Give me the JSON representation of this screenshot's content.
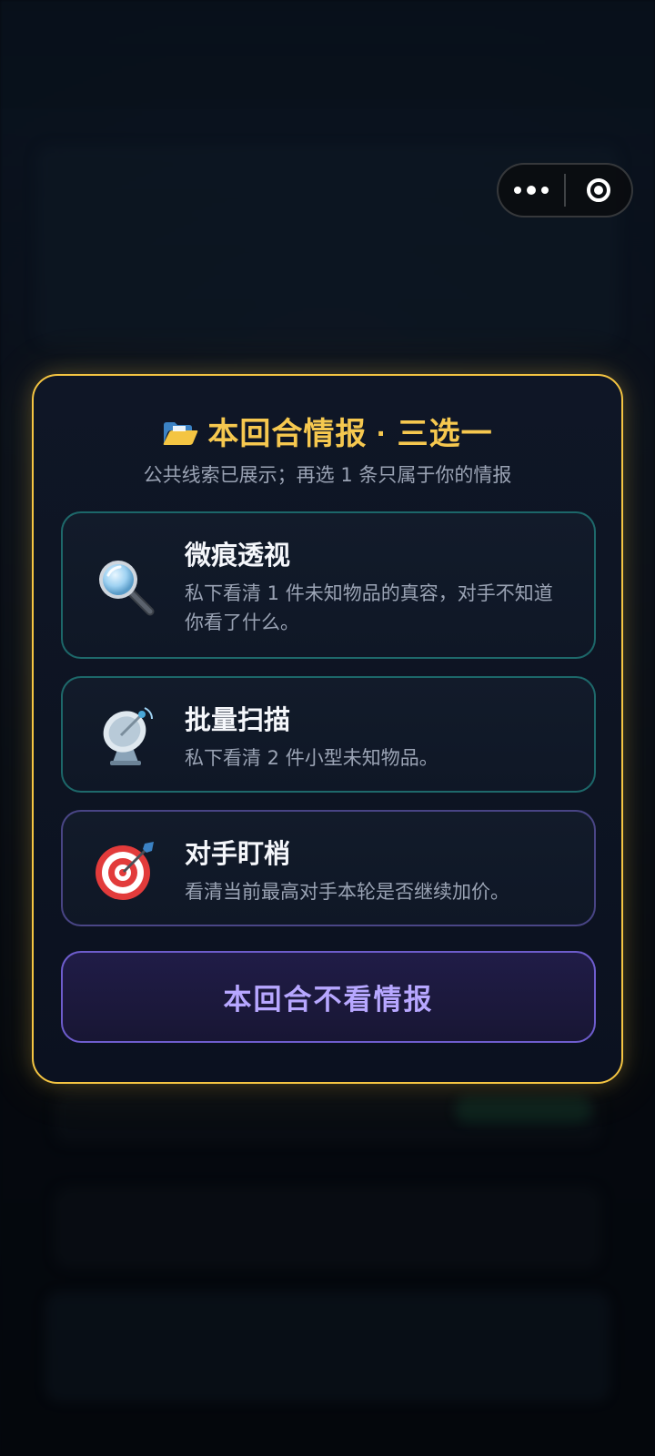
{
  "modal": {
    "title": "本回合情报 · 三选一",
    "subtitle": "公共线索已展示；再选 1 条只属于你的情报",
    "options": [
      {
        "icon": "magnifying-glass-icon",
        "title": "微痕透视",
        "description": "私下看清 1 件未知物品的真容，对手不知道你看了什么。"
      },
      {
        "icon": "satellite-dish-icon",
        "title": "批量扫描",
        "description": "私下看清 2 件小型未知物品。"
      },
      {
        "icon": "target-dart-icon",
        "title": "对手盯梢",
        "description": "看清当前最高对手本轮是否继续加价。"
      }
    ],
    "skip_label": "本回合不看情报"
  },
  "capsule": {
    "more_icon": "more-dots-icon",
    "close_icon": "close-circle-icon"
  },
  "colors": {
    "accent_gold": "#f6c84f",
    "teal_border": "#28aaa0",
    "purple_border": "#7869d2",
    "skip_text": "#b7a7ff"
  }
}
